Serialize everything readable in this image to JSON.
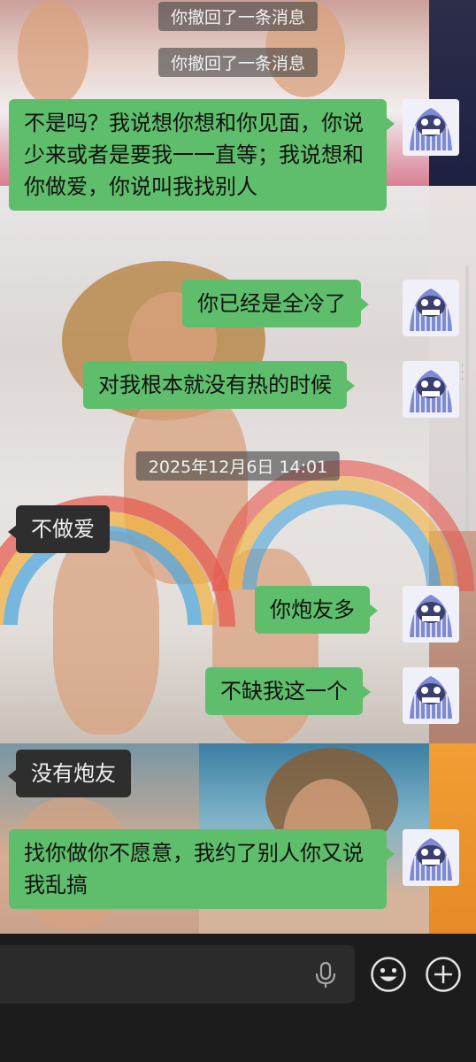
{
  "recalled_1": "你撤回了一条消息",
  "recalled_2": "你撤回了一条消息",
  "timestamp": "2025年12月6日 14:01",
  "messages": [
    {
      "sender": "me",
      "text": "不是吗？我说想你想和你见面，你说少来或者是要我一一直等；我说想和你做爱，你说叫我找别人"
    },
    {
      "sender": "me",
      "text": "你已经是全冷了"
    },
    {
      "sender": "me",
      "text": "对我根本就没有热的时候"
    },
    {
      "sender": "them",
      "text": "不做爱"
    },
    {
      "sender": "me",
      "text": "你炮友多"
    },
    {
      "sender": "me",
      "text": "不缺我这一个"
    },
    {
      "sender": "them",
      "text": "没有炮友"
    },
    {
      "sender": "me",
      "text": "找你做你不愿意，我约了别人你又说我乱搞"
    }
  ],
  "icons": {
    "voice": "microphone-icon",
    "emoji": "emoji-icon",
    "more": "add-icon"
  },
  "colors": {
    "my_bubble": "#5fbe6b",
    "their_bubble": "#2e2e2e",
    "input_bar": "#1c1c1c"
  }
}
